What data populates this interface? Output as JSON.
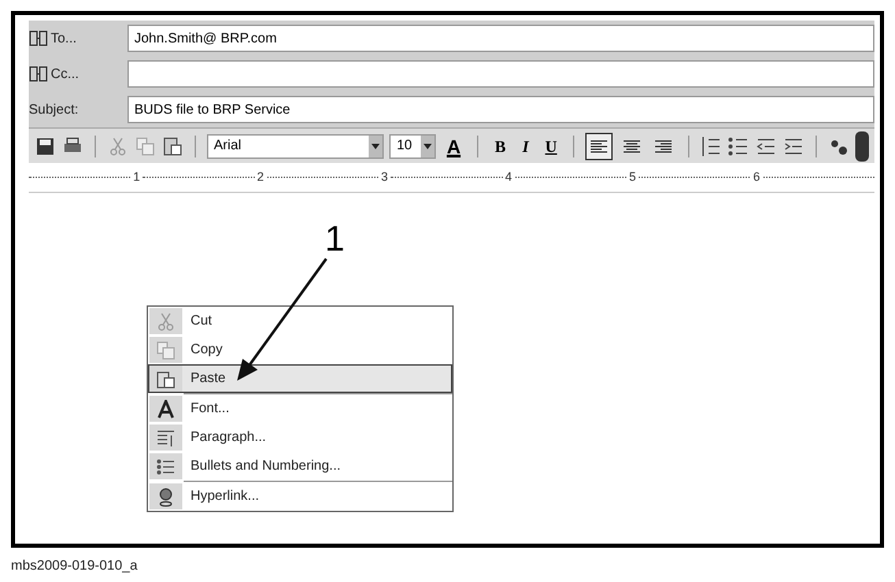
{
  "header": {
    "fields": [
      {
        "label": "To...",
        "value": "John.Smith@ BRP.com",
        "kind": "address"
      },
      {
        "label": "Cc...",
        "kind": "address"
      },
      {
        "label": "Subject:",
        "value": "BUDS file to BRP Service",
        "kind": "plain"
      }
    ]
  },
  "toolbar": {
    "font": "Arial",
    "size": "10",
    "font_color": "A",
    "bold": "B",
    "italic": "I",
    "underline": "U",
    "align": [
      {
        "selected": true
      },
      {
        "selected": false
      },
      {
        "selected": false
      }
    ]
  },
  "ruler": {
    "marks": [
      "1",
      "2",
      "3",
      "4",
      "5",
      "6"
    ]
  },
  "callout": {
    "number": "1"
  },
  "context_menu": {
    "items": [
      {
        "label": "Cut",
        "kind": "cut",
        "selected": false,
        "separator_before": false
      },
      {
        "label": "Copy",
        "kind": "copy",
        "selected": false,
        "separator_before": false
      },
      {
        "label": "Paste",
        "kind": "paste",
        "selected": true,
        "separator_before": false
      },
      {
        "label": "Font...",
        "kind": "font",
        "selected": false,
        "separator_before": true
      },
      {
        "label": "Paragraph...",
        "kind": "paragraph",
        "selected": false,
        "separator_before": false
      },
      {
        "label": "Bullets and Numbering...",
        "kind": "bullets",
        "selected": false,
        "separator_before": false
      },
      {
        "label": "Hyperlink...",
        "kind": "hyperlink",
        "selected": false,
        "separator_before": true
      }
    ]
  },
  "caption": "mbs2009-019-010_a"
}
